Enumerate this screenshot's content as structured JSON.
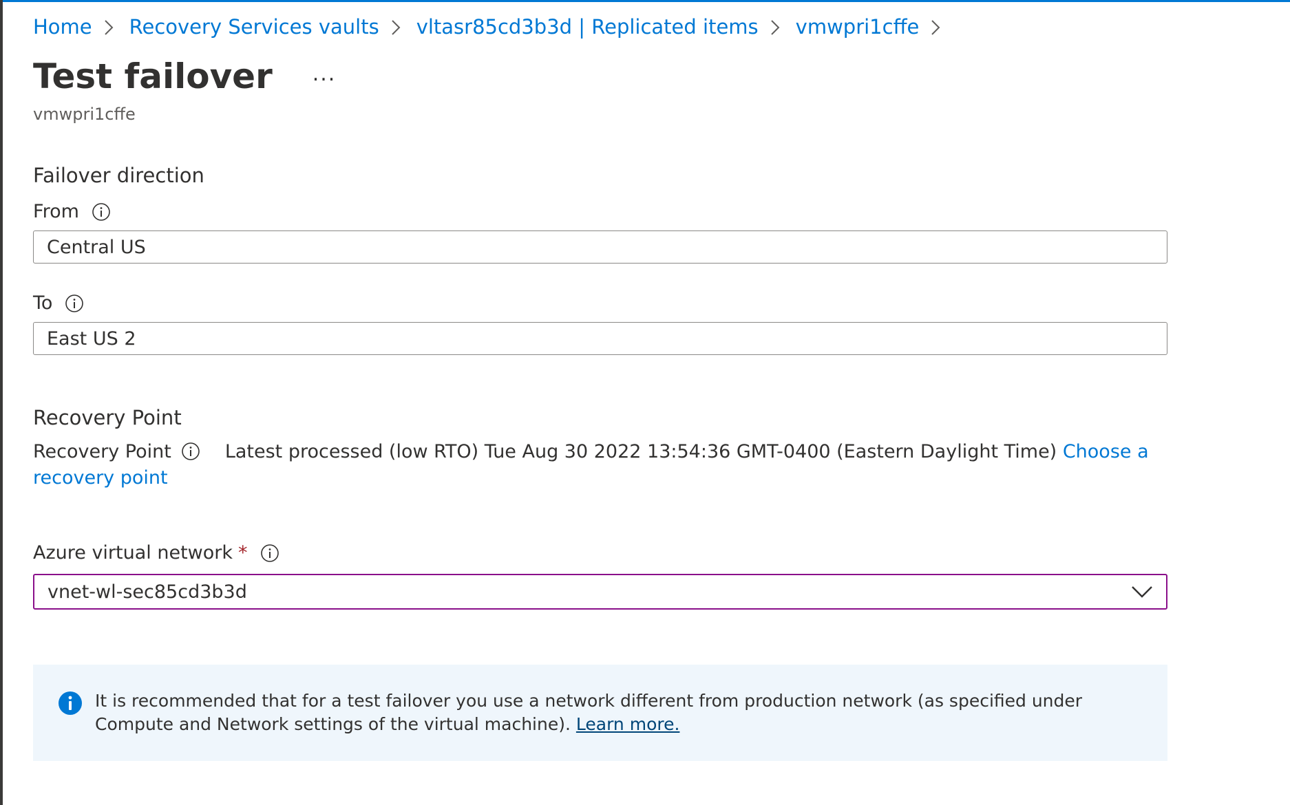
{
  "breadcrumb": {
    "items": [
      {
        "label": "Home"
      },
      {
        "label": "Recovery Services vaults"
      },
      {
        "label": "vltasr85cd3b3d | Replicated items"
      },
      {
        "label": "vmwpri1cffe"
      }
    ]
  },
  "header": {
    "title": "Test failover",
    "more_label": "...",
    "subtitle": "vmwpri1cffe"
  },
  "failover_direction": {
    "heading": "Failover direction",
    "from_label": "From",
    "from_value": "Central US",
    "to_label": "To",
    "to_value": "East US 2"
  },
  "recovery_point": {
    "heading": "Recovery Point",
    "label": "Recovery Point",
    "value": "Latest processed (low RTO) Tue Aug 30 2022 13:54:36 GMT-0400 (Eastern Daylight Time)",
    "choose_link": "Choose a recovery point"
  },
  "network": {
    "label": "Azure virtual network",
    "required_mark": "*",
    "selected": "vnet-wl-sec85cd3b3d"
  },
  "info_banner": {
    "text": "It is recommended that for a test failover you use a network different from production network (as specified under Compute and Network settings of the virtual machine).",
    "link": "Learn more."
  },
  "colors": {
    "accent": "#0078d4",
    "required": "#a4262c",
    "dropdown_focus": "#8a0f8a",
    "banner_bg": "#eff6fc"
  }
}
